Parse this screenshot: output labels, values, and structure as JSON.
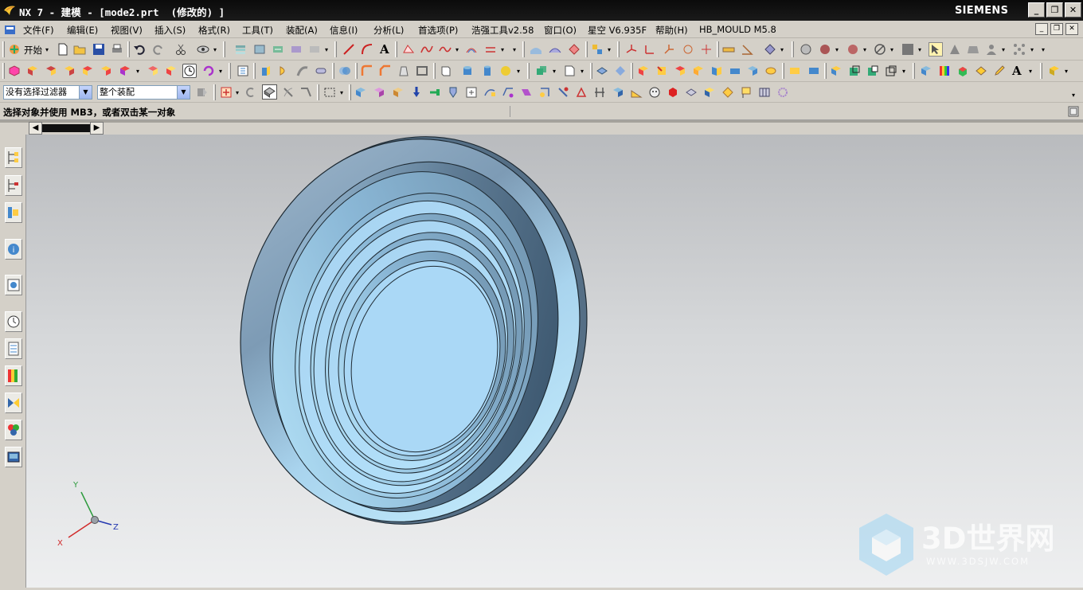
{
  "window": {
    "title": "NX 7 - 建模 - [mode2.prt  (修改的) ]",
    "brand": "SIEMENS",
    "controls": [
      "_",
      "❐",
      "✕"
    ]
  },
  "menu": {
    "items": [
      "文件(F)",
      "编辑(E)",
      "视图(V)",
      "插入(S)",
      "格式(R)",
      "工具(T)",
      "装配(A)",
      "信息(I)",
      "分析(L)",
      "首选项(P)",
      "浩强工具v2.58",
      "窗口(O)",
      "星空 V6.935F",
      "帮助(H)",
      "HB_MOULD M5.8"
    ]
  },
  "toolbar": {
    "start_label": "开始"
  },
  "selection": {
    "filter_value": "没有选择过滤器",
    "scope_value": "整个装配"
  },
  "status": {
    "prompt": "选择对象并使用 MB3，或者双击某一对象"
  },
  "triad": {
    "x_label": "X",
    "y_label": "Y",
    "z_label": "Z"
  },
  "watermark": {
    "brand": "3D世界网",
    "url": "WWW.3DSJW.COM"
  },
  "colors": {
    "title_bg": "#111111",
    "ui_gray": "#d4d0c8",
    "part_light": "#a9d8f5",
    "part_dark": "#6a8ba5",
    "part_edge": "#1e2a33"
  }
}
